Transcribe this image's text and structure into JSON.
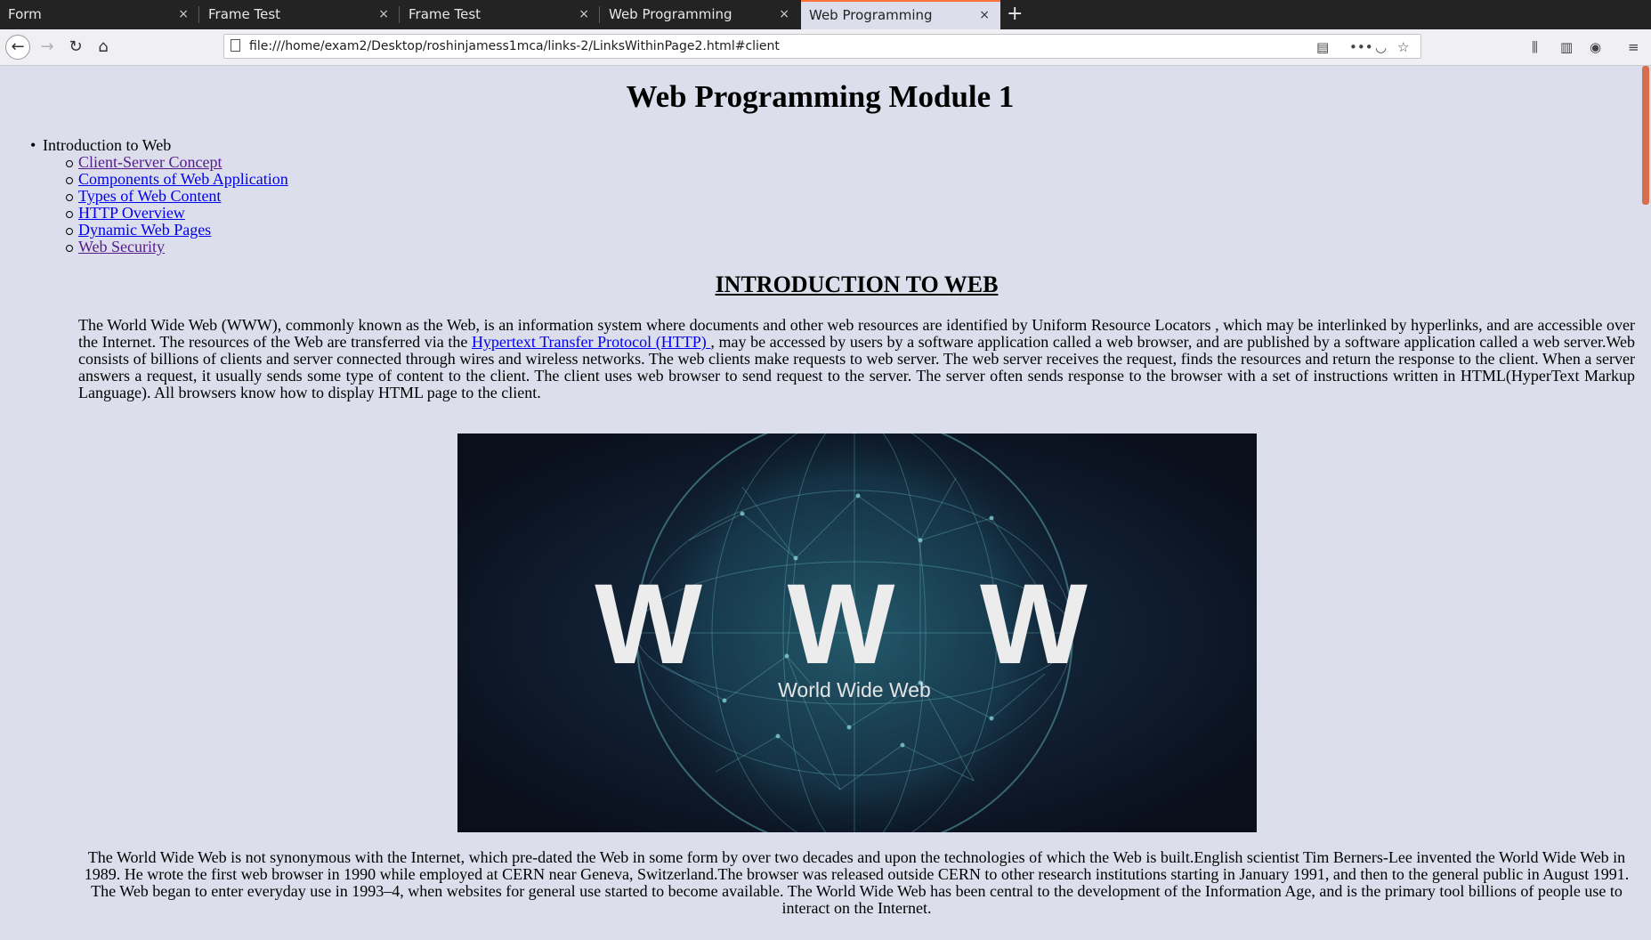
{
  "browser": {
    "tabs": [
      {
        "label": "Form",
        "active": false
      },
      {
        "label": "Frame Test",
        "active": false
      },
      {
        "label": "Frame Test",
        "active": false
      },
      {
        "label": "Web Programming",
        "active": false
      },
      {
        "label": "Web Programming",
        "active": true
      }
    ],
    "close_glyph": "×",
    "new_tab_glyph": "+",
    "url": "file:///home/exam2/Desktop/roshinjamess1mca/links-2/LinksWithinPage2.html#client",
    "accent_color": "#ff7139"
  },
  "page": {
    "title": "Web Programming Module 1",
    "toc": {
      "heading": "Introduction to Web",
      "items": [
        {
          "label": "Client-Server Concept",
          "visited": true
        },
        {
          "label": "Components of Web Application",
          "visited": false
        },
        {
          "label": "Types of Web Content",
          "visited": false
        },
        {
          "label": "HTTP Overview",
          "visited": false
        },
        {
          "label": "Dynamic Web Pages",
          "visited": false
        },
        {
          "label": "Web Security",
          "visited": true
        }
      ]
    },
    "section_heading": "INTRODUCTION TO WEB",
    "para1": {
      "before": "The World Wide Web (WWW), commonly known as the Web, is an information system where documents and other web resources are identified by Uniform Resource Locators , which may be interlinked by hyperlinks, and are accessible over the Internet. The resources of the Web are transferred via the ",
      "link": "Hypertext Transfer Protocol (HTTP) ",
      "after": ", may be accessed by users by a software application called a web browser, and are published by a software application called a web server.Web consists of billions of clients and server connected through wires and wireless networks. The web clients make requests to web server. The web server receives the request, finds the resources and return the response to the client. When a server answers a request, it usually sends some type of content to the client. The client uses web browser to send request to the server. The server often sends response to the browser with a set of instructions written in HTML(HyperText Markup Language). All browsers know how to display HTML page to the client."
    },
    "image": {
      "big_text": "W W W",
      "caption": "World Wide Web"
    },
    "para2": "The World Wide Web is not synonymous with the Internet, which pre-dated the Web in some form by over two decades and upon the technologies of which the Web is built.English scientist Tim Berners-Lee invented the World Wide Web in 1989. He wrote the first web browser in 1990 while employed at CERN near Geneva, Switzerland.The browser was released outside CERN to other research institutions starting in January 1991, and then to the general public in August 1991. The Web began to enter everyday use in 1993–4, when websites for general use started to become available. The World Wide Web has been central to the development of the Information Age, and is the primary tool billions of people use to interact on the Internet."
  }
}
